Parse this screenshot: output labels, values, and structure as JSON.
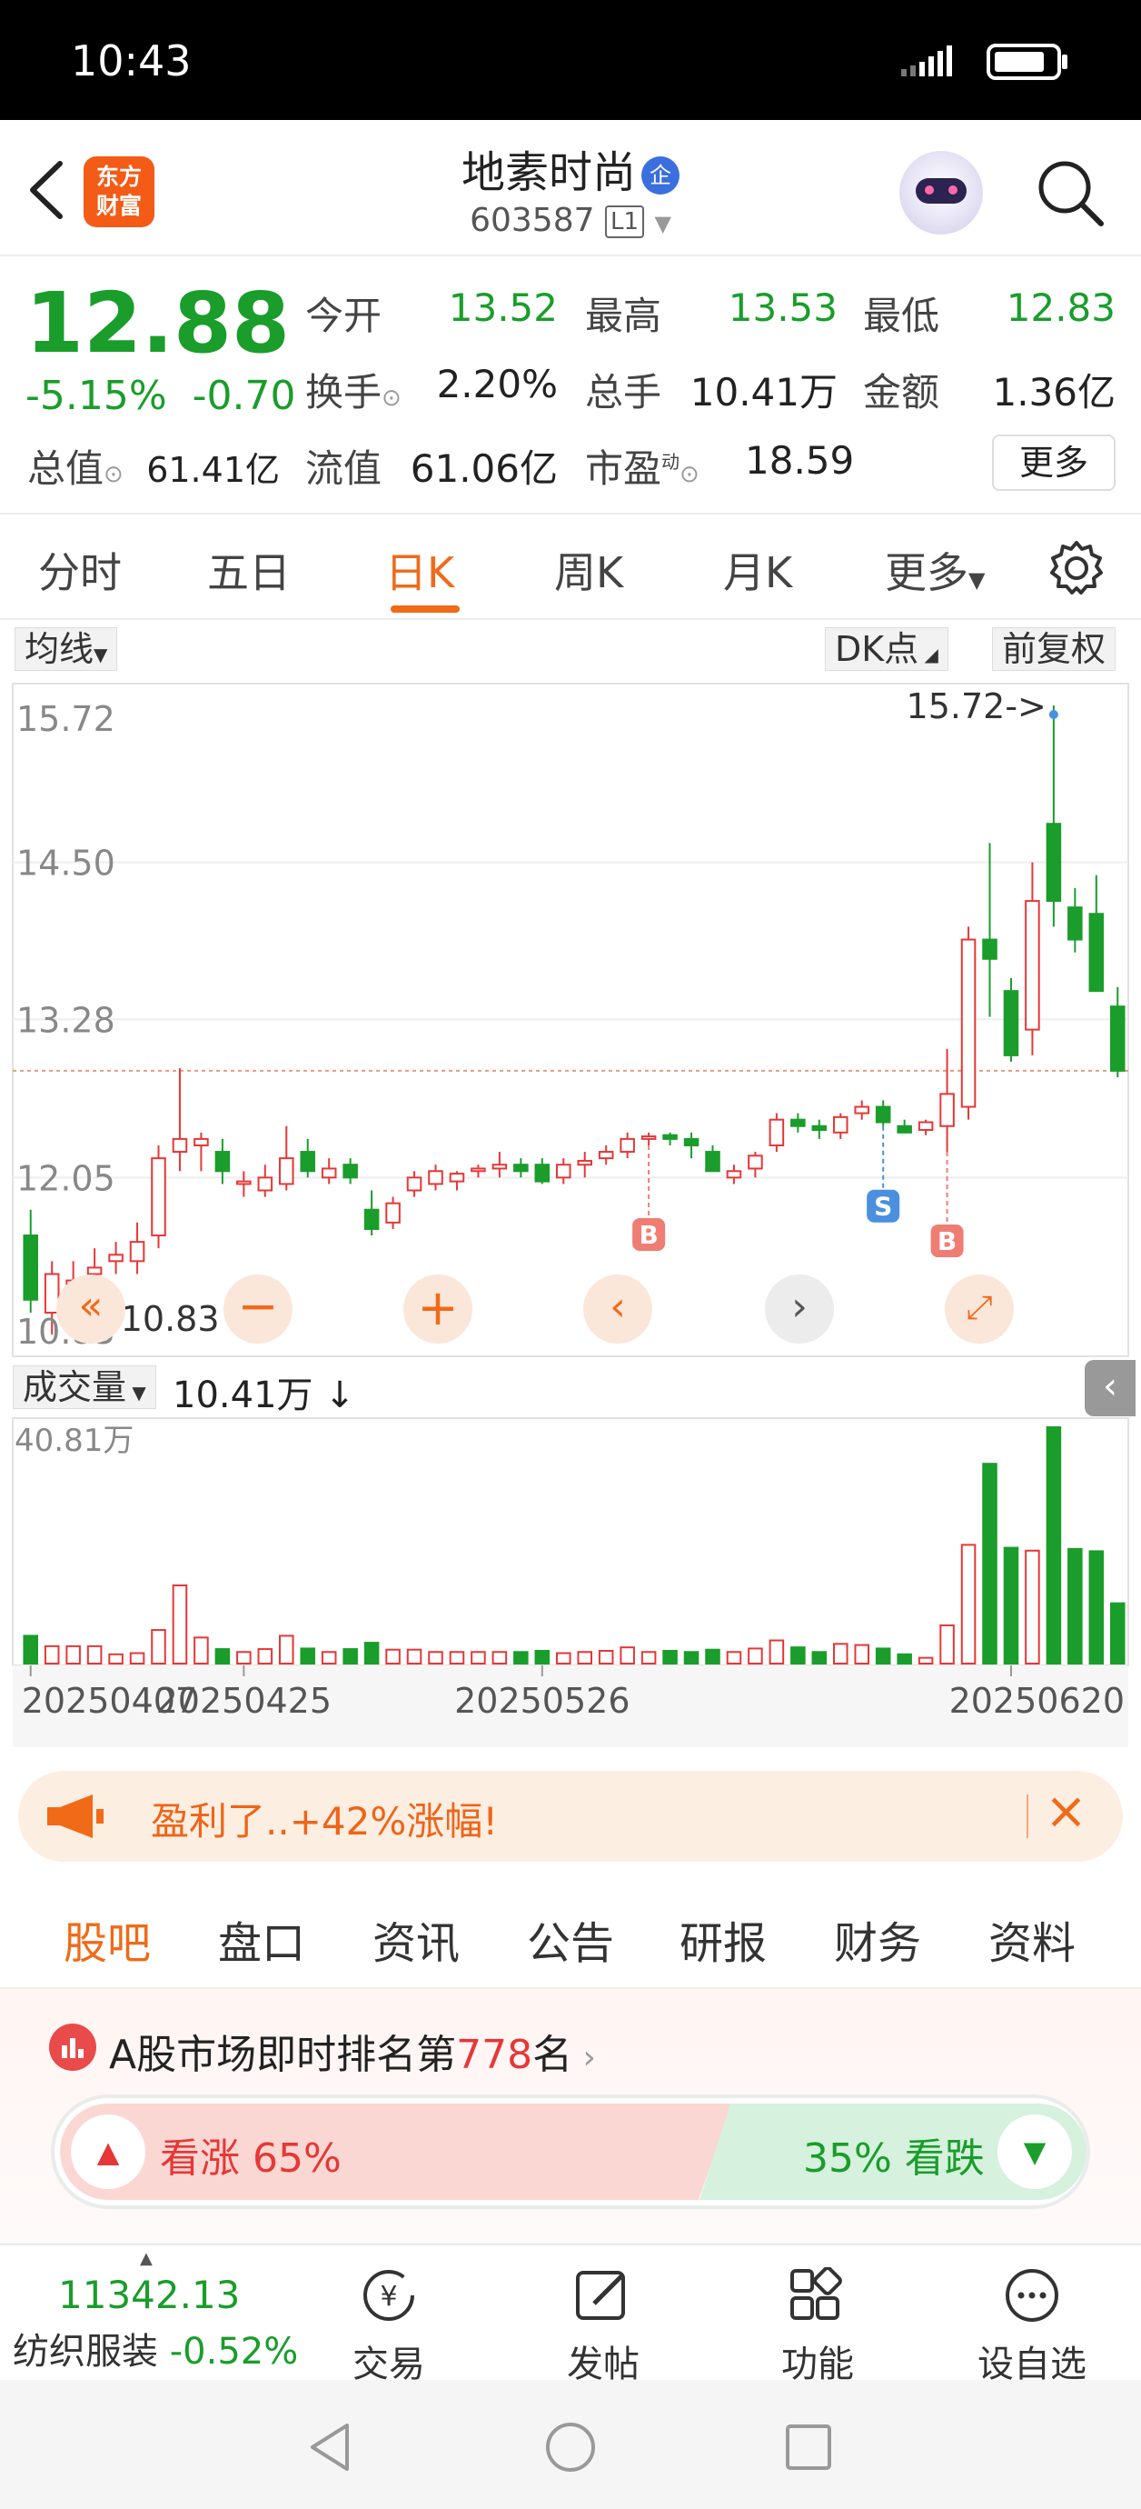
{
  "status": {
    "time": "10:43"
  },
  "header": {
    "app_logo": "东方\n财富",
    "stock_name": "地素时尚",
    "badge": "企",
    "code": "603587",
    "level": "L1"
  },
  "quote": {
    "price": "12.88",
    "change_pct": "-5.15%",
    "change": "-0.70",
    "open_label": "今开",
    "open": "13.52",
    "high_label": "最高",
    "high": "13.53",
    "low_label": "最低",
    "low": "12.83",
    "turnover_label": "换手",
    "turnover": "2.20%",
    "volume_label": "总手",
    "volume": "10.41万",
    "amount_label": "金额",
    "amount": "1.36亿",
    "mcap_label": "总值",
    "mcap": "61.41亿",
    "float_label": "流值",
    "float": "61.06亿",
    "pe_label": "市盈",
    "pe_sup": "动",
    "pe": "18.59",
    "more": "更多"
  },
  "tabs": [
    "分时",
    "五日",
    "日K",
    "周K",
    "月K",
    "更多"
  ],
  "active_tab": "日K",
  "chart_controls": {
    "ma": "均线",
    "dk": "DK点",
    "adjust": "前复权",
    "volume_menu": "成交量",
    "volume_value": "10.41万 ↓"
  },
  "chart_data": {
    "type": "candlestick",
    "price_axis": [
      "15.72",
      "14.50",
      "13.28",
      "12.05",
      "10.83"
    ],
    "ylim": [
      10.83,
      15.72
    ],
    "max_label": "15.72->",
    "min_label": "<-10.83",
    "volume_axis": "40.81万",
    "volume_max": 40.81,
    "x_labels": [
      "20250407",
      "20250425",
      "20250526",
      "20250620"
    ],
    "current_price_line": 12.88,
    "signals": [
      {
        "label": "B",
        "index": 29
      },
      {
        "label": "S",
        "index": 40
      },
      {
        "label": "B",
        "index": 43
      }
    ],
    "candles": [
      {
        "o": 11.6,
        "h": 11.8,
        "l": 11.0,
        "c": 11.1,
        "v": 4.8
      },
      {
        "o": 11.0,
        "h": 11.4,
        "l": 10.83,
        "c": 11.3,
        "v": 3.0
      },
      {
        "o": 11.15,
        "h": 11.4,
        "l": 11.0,
        "c": 11.25,
        "v": 3.0
      },
      {
        "o": 11.3,
        "h": 11.5,
        "l": 11.2,
        "c": 11.35,
        "v": 3.0
      },
      {
        "o": 11.4,
        "h": 11.55,
        "l": 11.3,
        "c": 11.45,
        "v": 1.6
      },
      {
        "o": 11.4,
        "h": 11.7,
        "l": 11.3,
        "c": 11.55,
        "v": 1.8
      },
      {
        "o": 11.6,
        "h": 12.3,
        "l": 11.5,
        "c": 12.2,
        "v": 5.8
      },
      {
        "o": 12.25,
        "h": 12.9,
        "l": 12.1,
        "c": 12.35,
        "v": 13.5
      },
      {
        "o": 12.3,
        "h": 12.4,
        "l": 12.1,
        "c": 12.35,
        "v": 4.5
      },
      {
        "o": 12.25,
        "h": 12.35,
        "l": 12.0,
        "c": 12.1,
        "v": 2.5
      },
      {
        "o": 12.0,
        "h": 12.1,
        "l": 11.9,
        "c": 12.02,
        "v": 2.0
      },
      {
        "o": 11.95,
        "h": 12.15,
        "l": 11.9,
        "c": 12.05,
        "v": 2.5
      },
      {
        "o": 12.0,
        "h": 12.45,
        "l": 11.95,
        "c": 12.2,
        "v": 4.8
      },
      {
        "o": 12.25,
        "h": 12.35,
        "l": 12.05,
        "c": 12.1,
        "v": 2.6
      },
      {
        "o": 12.05,
        "h": 12.2,
        "l": 12.0,
        "c": 12.12,
        "v": 2.0
      },
      {
        "o": 12.15,
        "h": 12.2,
        "l": 12.0,
        "c": 12.05,
        "v": 2.5
      },
      {
        "o": 11.8,
        "h": 11.95,
        "l": 11.6,
        "c": 11.65,
        "v": 3.6
      },
      {
        "o": 11.7,
        "h": 11.9,
        "l": 11.65,
        "c": 11.85,
        "v": 2.4
      },
      {
        "o": 11.95,
        "h": 12.1,
        "l": 11.9,
        "c": 12.05,
        "v": 2.4
      },
      {
        "o": 12.0,
        "h": 12.15,
        "l": 11.95,
        "c": 12.1,
        "v": 2.0
      },
      {
        "o": 12.02,
        "h": 12.1,
        "l": 11.95,
        "c": 12.08,
        "v": 2.0
      },
      {
        "o": 12.1,
        "h": 12.15,
        "l": 12.05,
        "c": 12.12,
        "v": 2.0
      },
      {
        "o": 12.12,
        "h": 12.25,
        "l": 12.05,
        "c": 12.15,
        "v": 2.0
      },
      {
        "o": 12.15,
        "h": 12.2,
        "l": 12.05,
        "c": 12.1,
        "v": 2.0
      },
      {
        "o": 12.15,
        "h": 12.2,
        "l": 12.0,
        "c": 12.02,
        "v": 2.2
      },
      {
        "o": 12.05,
        "h": 12.2,
        "l": 12.0,
        "c": 12.15,
        "v": 1.8
      },
      {
        "o": 12.15,
        "h": 12.25,
        "l": 12.05,
        "c": 12.18,
        "v": 2.0
      },
      {
        "o": 12.2,
        "h": 12.3,
        "l": 12.15,
        "c": 12.25,
        "v": 2.2
      },
      {
        "o": 12.25,
        "h": 12.4,
        "l": 12.2,
        "c": 12.35,
        "v": 2.8
      },
      {
        "o": 12.35,
        "h": 12.4,
        "l": 12.3,
        "c": 12.37,
        "v": 2.0
      },
      {
        "o": 12.38,
        "h": 12.4,
        "l": 12.3,
        "c": 12.35,
        "v": 2.2
      },
      {
        "o": 12.35,
        "h": 12.4,
        "l": 12.2,
        "c": 12.3,
        "v": 2.0
      },
      {
        "o": 12.25,
        "h": 12.3,
        "l": 12.15,
        "c": 12.1,
        "v": 2.4
      },
      {
        "o": 12.05,
        "h": 12.15,
        "l": 12.0,
        "c": 12.1,
        "v": 2.0
      },
      {
        "o": 12.12,
        "h": 12.25,
        "l": 12.05,
        "c": 12.22,
        "v": 2.6
      },
      {
        "o": 12.3,
        "h": 12.55,
        "l": 12.25,
        "c": 12.5,
        "v": 4.0
      },
      {
        "o": 12.5,
        "h": 12.55,
        "l": 12.4,
        "c": 12.45,
        "v": 2.8
      },
      {
        "o": 12.45,
        "h": 12.5,
        "l": 12.35,
        "c": 12.42,
        "v": 2.0
      },
      {
        "o": 12.4,
        "h": 12.55,
        "l": 12.35,
        "c": 12.52,
        "v": 3.4
      },
      {
        "o": 12.55,
        "h": 12.65,
        "l": 12.5,
        "c": 12.6,
        "v": 3.2
      },
      {
        "o": 12.6,
        "h": 12.65,
        "l": 12.45,
        "c": 12.48,
        "v": 2.6
      },
      {
        "o": 12.45,
        "h": 12.5,
        "l": 12.4,
        "c": 12.4,
        "v": 1.6
      },
      {
        "o": 12.42,
        "h": 12.5,
        "l": 12.38,
        "c": 12.48,
        "v": 1.0
      },
      {
        "o": 12.45,
        "h": 13.05,
        "l": 12.25,
        "c": 12.7,
        "v": 6.6
      },
      {
        "o": 12.6,
        "h": 14.0,
        "l": 12.5,
        "c": 13.9,
        "v": 20.5
      },
      {
        "o": 13.9,
        "h": 14.65,
        "l": 13.3,
        "c": 13.75,
        "v": 34.5
      },
      {
        "o": 13.5,
        "h": 13.6,
        "l": 12.95,
        "c": 13.0,
        "v": 20.0
      },
      {
        "o": 13.2,
        "h": 14.5,
        "l": 13.0,
        "c": 14.2,
        "v": 19.5
      },
      {
        "o": 14.8,
        "h": 15.72,
        "l": 14.0,
        "c": 14.2,
        "v": 40.81
      },
      {
        "o": 14.15,
        "h": 14.3,
        "l": 13.8,
        "c": 13.9,
        "v": 19.8
      },
      {
        "o": 14.1,
        "h": 14.4,
        "l": 13.55,
        "c": 13.5,
        "v": 19.4
      },
      {
        "o": 13.38,
        "h": 13.53,
        "l": 12.83,
        "c": 12.88,
        "v": 10.41
      }
    ]
  },
  "banner": {
    "text": "盈利了..+42%涨幅!"
  },
  "subtabs": [
    "股吧",
    "盘口",
    "资讯",
    "公告",
    "研报",
    "财务",
    "资料"
  ],
  "active_subtab": "股吧",
  "rank": {
    "prefix": "A股市场即时排名第",
    "number": "778",
    "suffix": "名",
    "bull_label": "看涨 65%",
    "bear_label": "35% 看跌"
  },
  "bottom": {
    "index_value": "11342.13",
    "index_name": "纺织服装",
    "index_change": "-0.52%",
    "items": [
      "交易",
      "发帖",
      "功能",
      "设自选"
    ]
  },
  "colors": {
    "up": "#e63737",
    "down": "#1a9d2b",
    "accent": "#f06a18"
  }
}
